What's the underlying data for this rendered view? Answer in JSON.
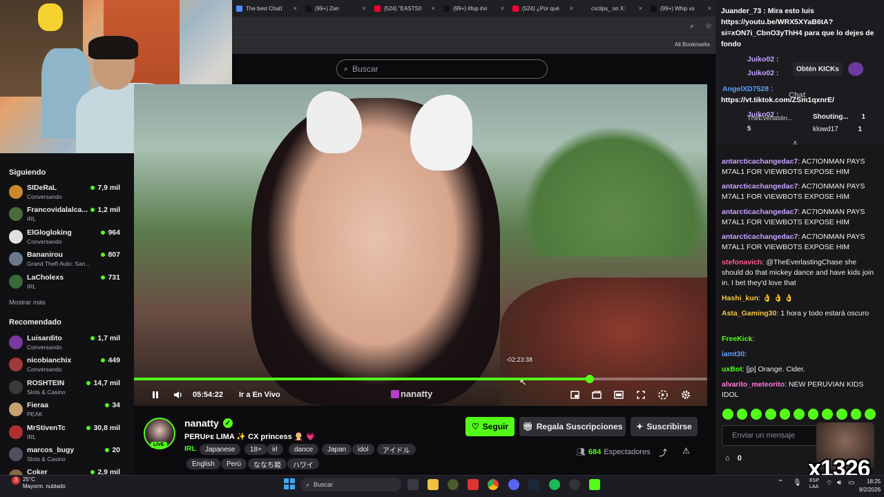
{
  "browser": {
    "tabs": [
      {
        "label": "The best ChatI",
        "color": "#4f8cff"
      },
      {
        "label": "(99+) Zan",
        "color": "#111111"
      },
      {
        "label": "(524) \"EASTSII",
        "color": "#ff0033"
      },
      {
        "label": "(99+) #fup #vi",
        "color": "#111111"
      },
      {
        "label": "(524) ¿Por qué",
        "color": "#ff0033"
      },
      {
        "label": "cxclips_ on X:",
        "color": "#222222"
      },
      {
        "label": "(99+) Whip vs",
        "color": "#111111"
      }
    ],
    "bookmarks_label": "All Bookmarks"
  },
  "search": {
    "placeholder": "Buscar"
  },
  "sidebar": {
    "following_header": "Siguiendo",
    "following": [
      {
        "name": "SIDeRaL",
        "category": "Conversando",
        "viewers": "7,9 mil",
        "avatar_color": "#c98a2e"
      },
      {
        "name": "Francovidalalca...",
        "category": "IRL",
        "viewers": "1,2 mil",
        "avatar_color": "#4a6a3a"
      },
      {
        "name": "ElGlogloking",
        "category": "Conversando",
        "viewers": "964",
        "avatar_color": "#e0e0e0"
      },
      {
        "name": "Bananirou",
        "category": "Grand Theft Auto: San...",
        "viewers": "807",
        "avatar_color": "#6a7a8a"
      },
      {
        "name": "LaCholexs",
        "category": "IRL",
        "viewers": "731",
        "avatar_color": "#3a6a3a"
      }
    ],
    "show_more": "Mostrar más",
    "recommended_header": "Recomendado",
    "recommended": [
      {
        "name": "Luisardito",
        "category": "Conversando",
        "viewers": "1,7 mil",
        "avatar_color": "#7a3aa0"
      },
      {
        "name": "nicobianchix",
        "category": "Conversando",
        "viewers": "449",
        "avatar_color": "#a03a3a"
      },
      {
        "name": "ROSHTEIN",
        "category": "Slots & Casino",
        "viewers": "14,7 mil",
        "avatar_color": "#3a3a3a"
      },
      {
        "name": "Fieraa",
        "category": "PEAK",
        "viewers": "34",
        "avatar_color": "#c8a070"
      },
      {
        "name": "MrStivenTc",
        "category": "IRL",
        "viewers": "30,8 mil",
        "avatar_color": "#b03030"
      },
      {
        "name": "marcos_bugy",
        "category": "Slots & Casino",
        "viewers": "20",
        "avatar_color": "#505060"
      },
      {
        "name": "Coker",
        "category": "",
        "viewers": "2,9 mil",
        "avatar_color": "#8a6a4a"
      }
    ]
  },
  "player": {
    "elapsed": "05:54:22",
    "go_live": "Ir a En Vivo",
    "hover_time": "-02:23:38",
    "progress": 0.795,
    "logo": "nanatty",
    "controls": [
      "pause-icon",
      "volume-icon",
      "miniplayer-icon",
      "clip-icon",
      "theater-icon",
      "fullscreen-icon",
      "speed-icon",
      "settings-icon"
    ]
  },
  "channel": {
    "name": "nanatty",
    "live_badge": "LIVE",
    "title": "PERUᴘᴇ LIMA ✨   CX princess 🤶 💗",
    "category": "IRL",
    "tags": [
      "Japanese",
      "18+",
      "irl",
      "dance",
      "Japan",
      "idol",
      "アイドル",
      "English",
      "Perù",
      "ななち姫",
      "ハワイ"
    ],
    "follow": "Seguir",
    "gift": "Regala Suscripciones",
    "subscribe": "Suscribirse",
    "viewers": "684",
    "viewers_label": "Espectadores"
  },
  "chat": {
    "pinned": {
      "user": "Juander_73",
      "lines": [
        "Juander_73 : Mira esto luis",
        "https://youtu.be/WRX5XYaB6tA?",
        "si=xON7i_CbnO3yThH4 para que lo dejes de",
        "fondo"
      ]
    },
    "kicks_button": "Obtén KICKs",
    "header": "Chat",
    "overlay_users": [
      "Juiko02 :",
      "Juiko02 :",
      "AngelXD7528 :",
      "Juiko02 :"
    ],
    "tiktok_link": "https://vt.tiktok.com/ZSm1qxnrE/",
    "everlasting": "TheEverlastin...",
    "everlasting_count": "5",
    "shouting": "Shouting...",
    "shouting_count": "1",
    "klowd": "klowd17",
    "klowd_count": "1",
    "messages": [
      {
        "user": "antarcticachangedac7",
        "text": "AC7IONMAN PAYS M7AL1 FOR VIEWBOTS EXPOSE HIM",
        "color": "#c6a4ff"
      },
      {
        "user": "antarcticachangedac7",
        "text": "AC7IONMAN PAYS M7AL1 FOR VIEWBOTS EXPOSE HIM",
        "color": "#c6a4ff"
      },
      {
        "user": "antarcticachangedac7",
        "text": "AC7IONMAN PAYS M7AL1 FOR VIEWBOTS EXPOSE HIM",
        "color": "#c6a4ff"
      },
      {
        "user": "antarcticachangedac7",
        "text": "AC7IONMAN PAYS M7AL1 FOR VIEWBOTS EXPOSE HIM",
        "color": "#c6a4ff"
      },
      {
        "user": "stefonavich",
        "text": "@TheEverlastingChase she should do that mickey dance and have kids join in. I bet they'd love that",
        "color": "#ff5a8a"
      },
      {
        "user": "Hashi_kun",
        "text": "👌 👌 👌",
        "color": "#f5c542"
      },
      {
        "user": "Asta_Gaming30",
        "text": "1 hora y todo estará oscuro",
        "color": "#f5c542"
      },
      {
        "user": "FreeKick",
        "text": "",
        "color": "#53fc18"
      },
      {
        "user": "iamt30",
        "text": "",
        "color": "#5aa0ff"
      },
      {
        "user": "uxBot",
        "text": "[jp] Orange. Cider.",
        "color": "#53fc18"
      },
      {
        "user": "alvarito_meteorito",
        "text": "NEW PERUVIAN KIDS IDOL",
        "color": "#ff7ad9"
      }
    ],
    "input_placeholder": "Enviar un mensaje",
    "kick_count": "0",
    "overlay_text": "x1326"
  },
  "taskbar": {
    "temp": "25°C",
    "weather": "Mayorm. nublado",
    "weather_badge": "3",
    "search": "Buscar",
    "lang_1": "ESP",
    "lang_2": "LAA",
    "time": "18:25",
    "date": "8/2/2026"
  }
}
